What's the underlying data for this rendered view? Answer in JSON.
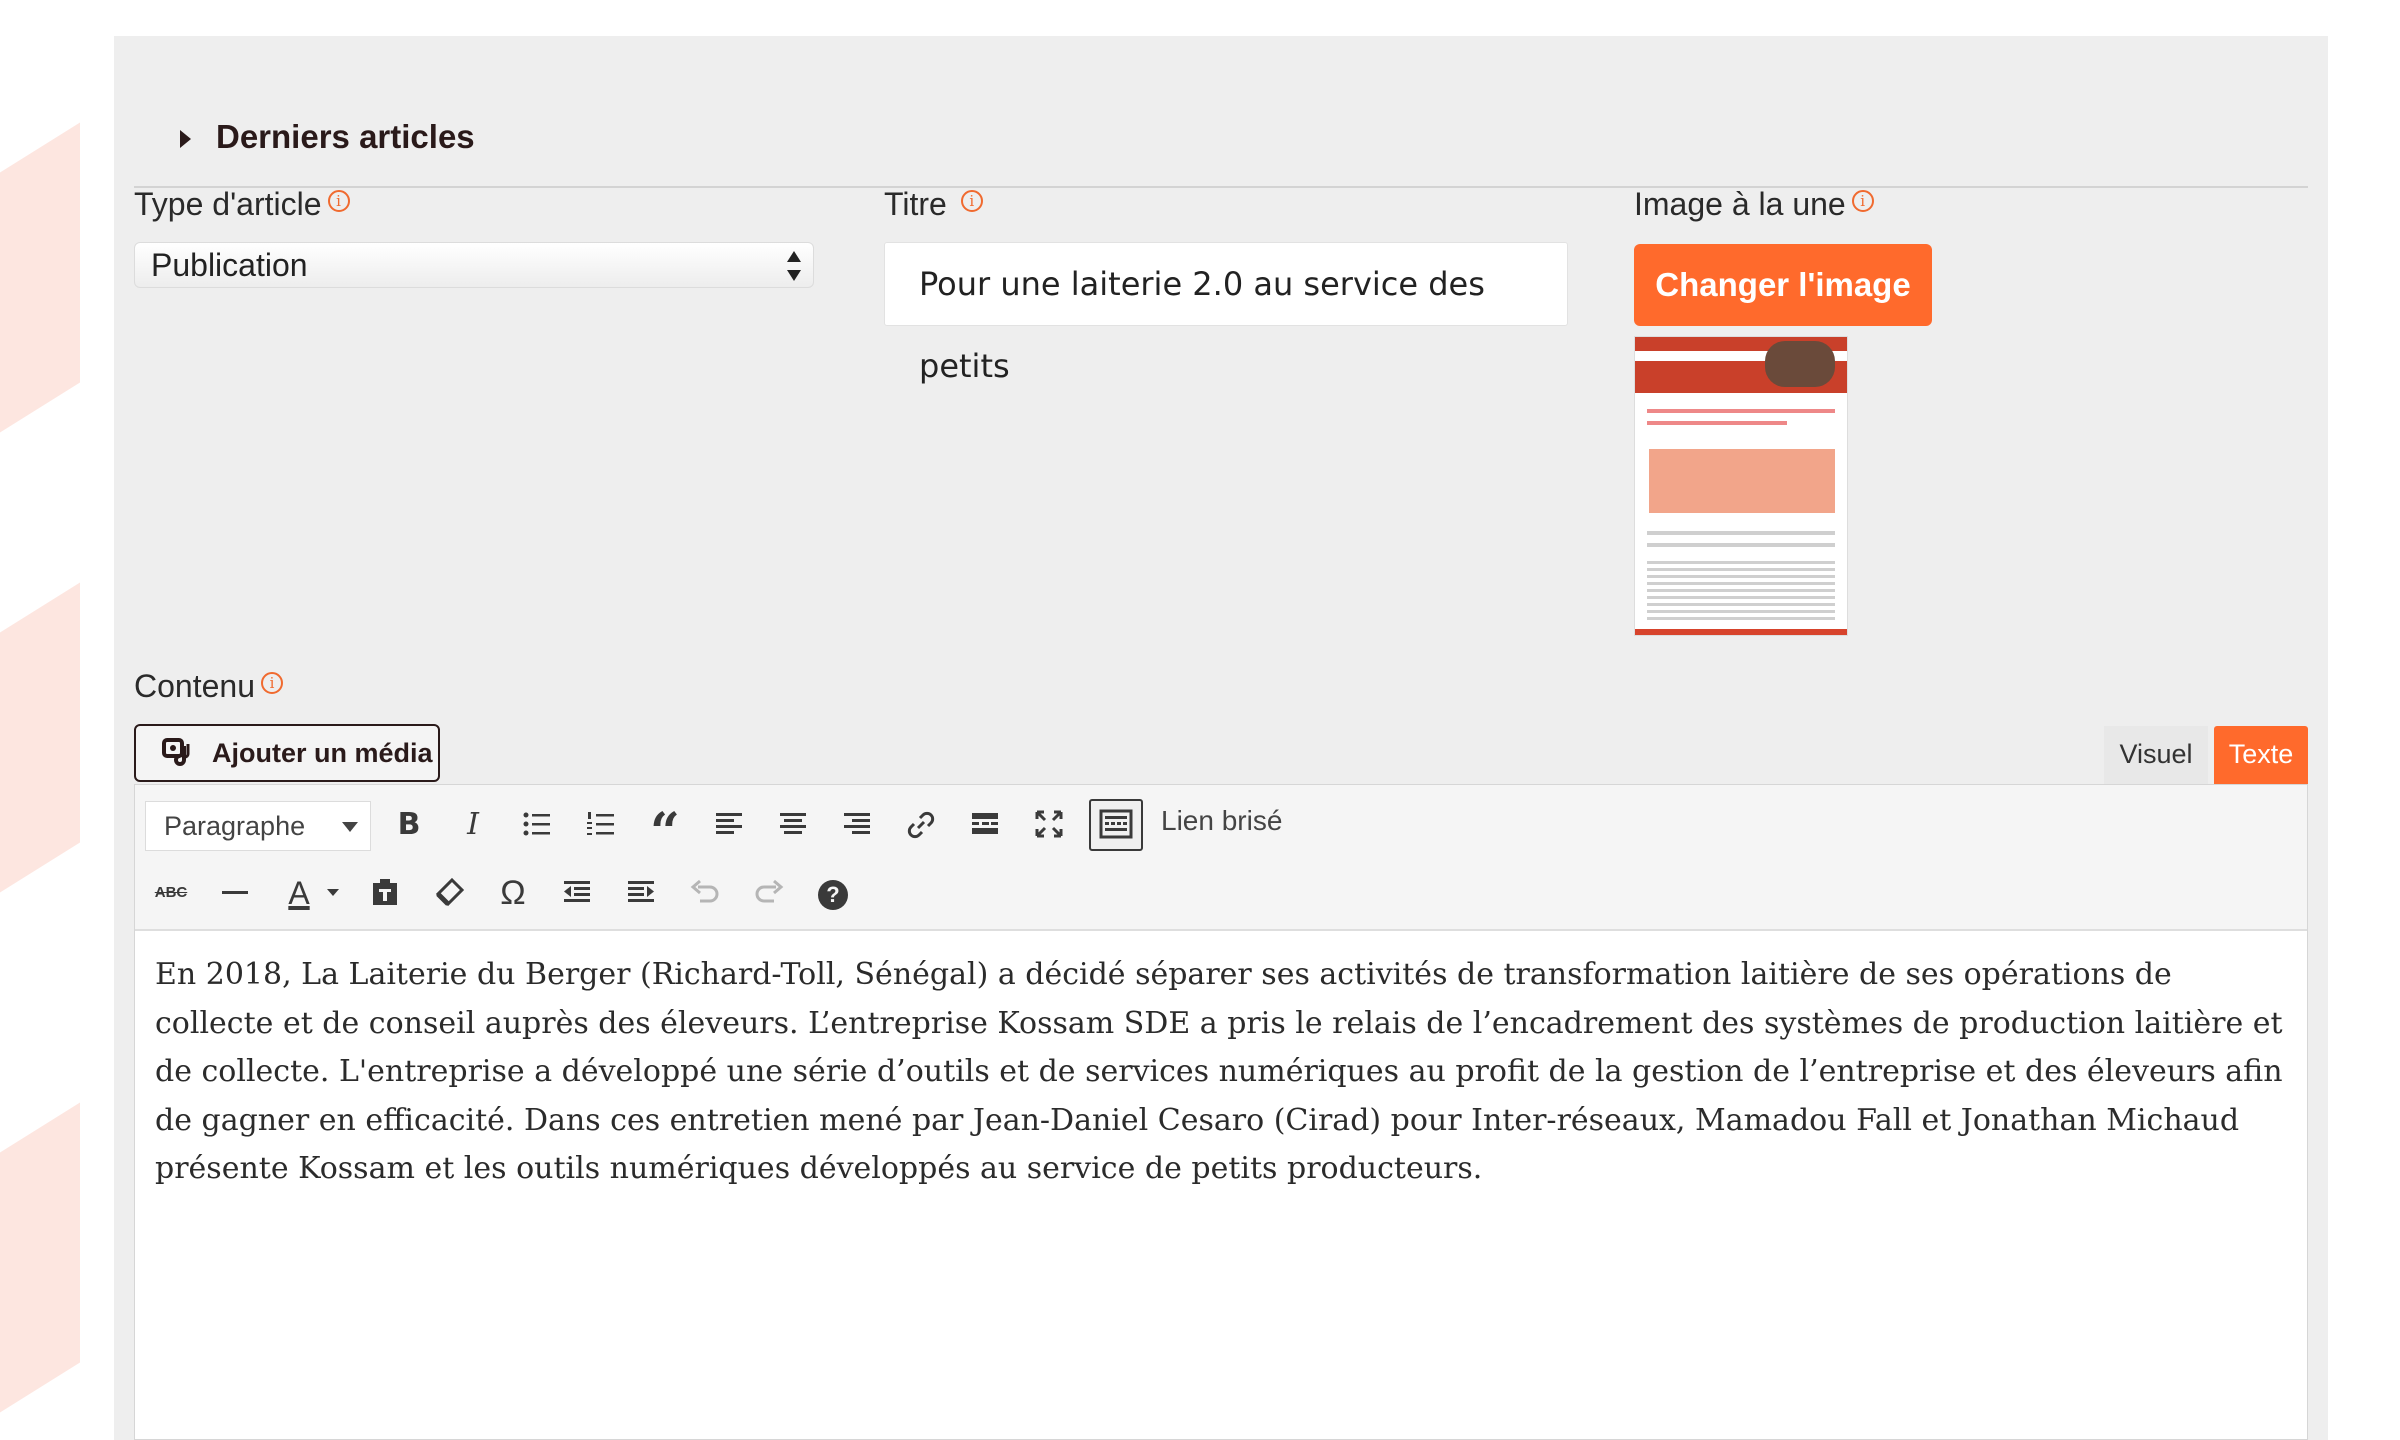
{
  "section": {
    "title": "Derniers articles"
  },
  "fields": {
    "type": {
      "label": "Type d'article",
      "value": "Publication"
    },
    "title": {
      "label": "Titre",
      "value": "Pour une laiterie 2.0 au service des petits"
    },
    "image": {
      "label": "Image à la une",
      "button_label": "Changer l'image"
    },
    "content": {
      "label": "Contenu"
    }
  },
  "editor": {
    "add_media_label": "Ajouter un média",
    "tabs": {
      "visual": "Visuel",
      "text": "Texte"
    },
    "format_select": "Paragraphe",
    "broken_link_label": "Lien brisé",
    "toolbar_row1_icons": [
      "bold-icon",
      "italic-icon",
      "bullet-list-icon",
      "numbered-list-icon",
      "blockquote-icon",
      "align-left-icon",
      "align-center-icon",
      "align-right-icon",
      "link-icon",
      "read-more-icon",
      "fullscreen-icon",
      "toolbar-toggle-icon"
    ],
    "toolbar_row2_icons": [
      "strikethrough-icon",
      "horizontal-line-icon",
      "text-color-icon",
      "paste-text-icon",
      "clear-formatting-icon",
      "special-character-icon",
      "outdent-icon",
      "indent-icon",
      "undo-icon",
      "redo-icon",
      "help-icon"
    ],
    "text_color_glyph": "A",
    "strike_glyph": "ABC",
    "omega_glyph": "Ω",
    "help_glyph": "?",
    "bold_glyph": "B",
    "italic_glyph": "I",
    "quote_glyph": "“",
    "body": "En 2018, La Laiterie du Berger (Richard-Toll, Sénégal) a décidé séparer ses activités de transformation laitière de ses opérations de collecte et de conseil auprès des éleveurs. L’entreprise Kossam SDE a pris le relais de l’encadrement des systèmes de production laitière et de collecte. L'entreprise a développé une série d’outils et de services numériques au profit de la gestion de l’entreprise et des éleveurs afin de gagner en efficacité. Dans ces entretien mené par Jean-Daniel Cesaro (Cirad) pour Inter-réseaux, Mamadou Fall et Jonathan Michaud présente Kossam et les outils numériques développés au service de petits producteurs."
  },
  "colors": {
    "accent": "#ff6a2c",
    "panel": "#eeeeee",
    "deco": "#fde6e0"
  },
  "info_glyph": "i"
}
